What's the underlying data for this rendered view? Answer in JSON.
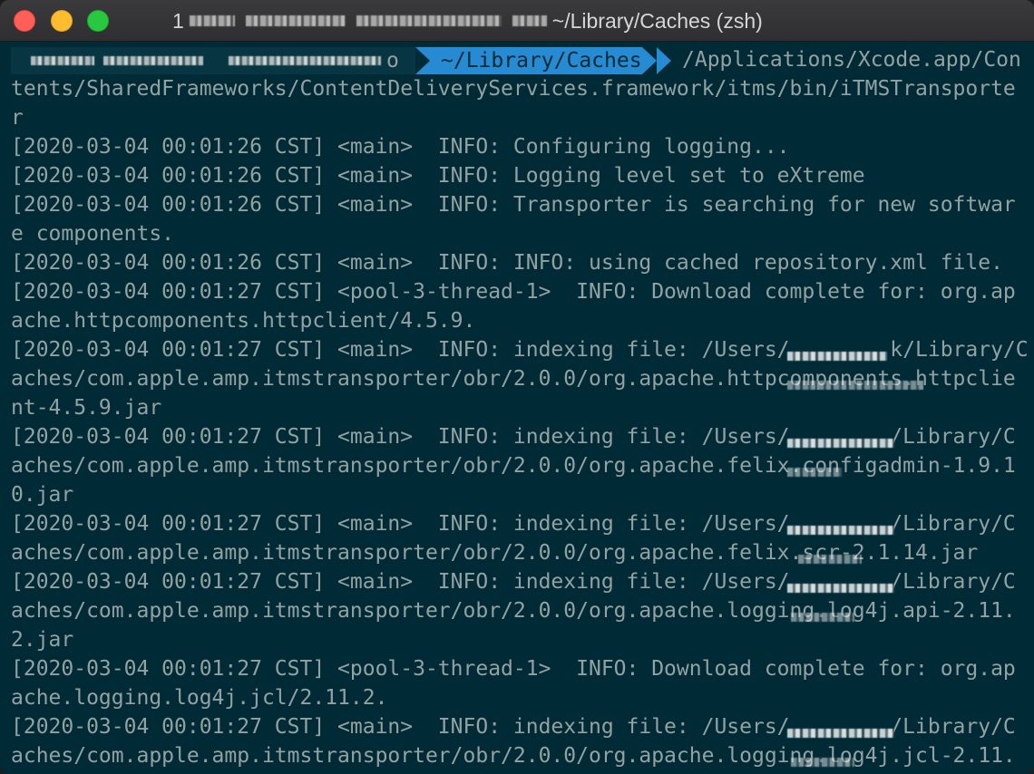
{
  "window": {
    "title_prefix": "1",
    "title_suffix": "~/Library/Caches (zsh)"
  },
  "prompt": {
    "user_tail": "o",
    "directory": "~/Library/Caches",
    "command_first": "/Applications/Xcode.app/Con"
  },
  "colors": {
    "background": "#002b36",
    "prompt_user_bg": "#073642",
    "prompt_dir_bg": "#268bd2",
    "text": "#93a1a1"
  },
  "lines": [
    "tents/SharedFrameworks/ContentDeliveryServices.framework/itms/bin/iTMSTransporte",
    "r",
    "[2020-03-04 00:01:26 CST] <main>  INFO: Configuring logging...",
    "[2020-03-04 00:01:26 CST] <main>  INFO: Logging level set to eXtreme",
    "[2020-03-04 00:01:26 CST] <main>  INFO: Transporter is searching for new softwar",
    "e components.",
    "[2020-03-04 00:01:26 CST] <main>  INFO: INFO: using cached repository.xml file.",
    "[2020-03-04 00:01:27 CST] <pool-3-thread-1>  INFO: Download complete for: org.ap",
    "ache.httpcomponents.httpclient/4.5.9.",
    "[2020-03-04 00:01:27 CST] <main>  INFO: indexing file: /Users/        k/Library/C",
    "aches/com.apple.amp.itmstransporter/obr/2.0.0/org.apache.httpcomponents.httpclie",
    "nt-4.5.9.jar",
    "[2020-03-04 00:01:27 CST] <main>  INFO: indexing file: /Users/        /Library/C",
    "aches/com.apple.amp.itmstransporter/obr/2.0.0/org.apache.felix.configadmin-1.9.1",
    "0.jar",
    "[2020-03-04 00:01:27 CST] <main>  INFO: indexing file: /Users/        /Library/C",
    "aches/com.apple.amp.itmstransporter/obr/2.0.0/org.apache.felix.scr-2.1.14.jar",
    "[2020-03-04 00:01:27 CST] <main>  INFO: indexing file: /Users/        /Library/C",
    "aches/com.apple.amp.itmstransporter/obr/2.0.0/org.apache.logging.log4j.api-2.11.",
    "2.jar",
    "[2020-03-04 00:01:27 CST] <pool-3-thread-1>  INFO: Download complete for: org.ap",
    "ache.logging.log4j.jcl/2.11.2.",
    "[2020-03-04 00:01:27 CST] <main>  INFO: indexing file: /Users/        /Library/C",
    "aches/com.apple.amp.itmstransporter/obr/2.0.0/org.apache.logging.log4j.jcl-2.11."
  ]
}
